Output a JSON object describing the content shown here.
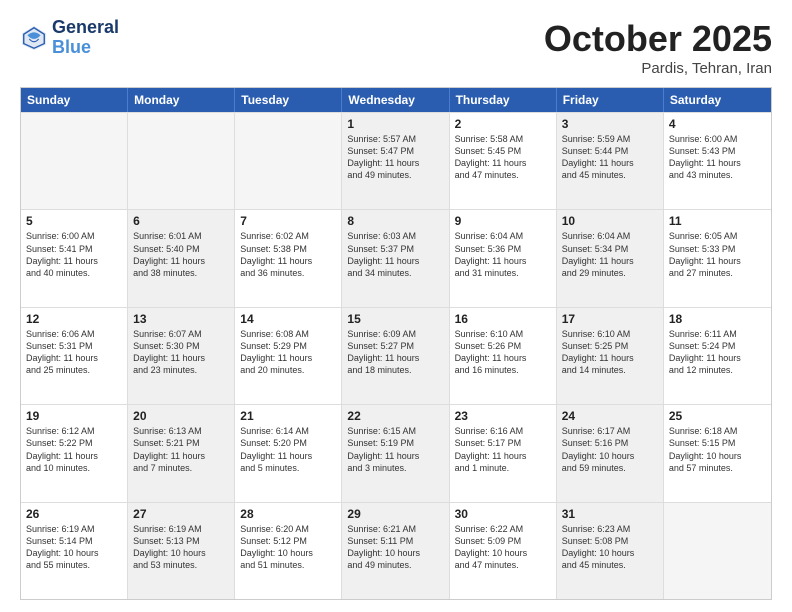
{
  "header": {
    "logo_line1": "General",
    "logo_line2": "Blue",
    "month": "October 2025",
    "location": "Pardis, Tehran, Iran"
  },
  "weekdays": [
    "Sunday",
    "Monday",
    "Tuesday",
    "Wednesday",
    "Thursday",
    "Friday",
    "Saturday"
  ],
  "rows": [
    [
      {
        "day": "",
        "text": "",
        "empty": true
      },
      {
        "day": "",
        "text": "",
        "empty": true
      },
      {
        "day": "",
        "text": "",
        "empty": true
      },
      {
        "day": "1",
        "text": "Sunrise: 5:57 AM\nSunset: 5:47 PM\nDaylight: 11 hours\nand 49 minutes.",
        "shaded": true
      },
      {
        "day": "2",
        "text": "Sunrise: 5:58 AM\nSunset: 5:45 PM\nDaylight: 11 hours\nand 47 minutes.",
        "shaded": false
      },
      {
        "day": "3",
        "text": "Sunrise: 5:59 AM\nSunset: 5:44 PM\nDaylight: 11 hours\nand 45 minutes.",
        "shaded": true
      },
      {
        "day": "4",
        "text": "Sunrise: 6:00 AM\nSunset: 5:43 PM\nDaylight: 11 hours\nand 43 minutes.",
        "shaded": false
      }
    ],
    [
      {
        "day": "5",
        "text": "Sunrise: 6:00 AM\nSunset: 5:41 PM\nDaylight: 11 hours\nand 40 minutes.",
        "shaded": false
      },
      {
        "day": "6",
        "text": "Sunrise: 6:01 AM\nSunset: 5:40 PM\nDaylight: 11 hours\nand 38 minutes.",
        "shaded": true
      },
      {
        "day": "7",
        "text": "Sunrise: 6:02 AM\nSunset: 5:38 PM\nDaylight: 11 hours\nand 36 minutes.",
        "shaded": false
      },
      {
        "day": "8",
        "text": "Sunrise: 6:03 AM\nSunset: 5:37 PM\nDaylight: 11 hours\nand 34 minutes.",
        "shaded": true
      },
      {
        "day": "9",
        "text": "Sunrise: 6:04 AM\nSunset: 5:36 PM\nDaylight: 11 hours\nand 31 minutes.",
        "shaded": false
      },
      {
        "day": "10",
        "text": "Sunrise: 6:04 AM\nSunset: 5:34 PM\nDaylight: 11 hours\nand 29 minutes.",
        "shaded": true
      },
      {
        "day": "11",
        "text": "Sunrise: 6:05 AM\nSunset: 5:33 PM\nDaylight: 11 hours\nand 27 minutes.",
        "shaded": false
      }
    ],
    [
      {
        "day": "12",
        "text": "Sunrise: 6:06 AM\nSunset: 5:31 PM\nDaylight: 11 hours\nand 25 minutes.",
        "shaded": false
      },
      {
        "day": "13",
        "text": "Sunrise: 6:07 AM\nSunset: 5:30 PM\nDaylight: 11 hours\nand 23 minutes.",
        "shaded": true
      },
      {
        "day": "14",
        "text": "Sunrise: 6:08 AM\nSunset: 5:29 PM\nDaylight: 11 hours\nand 20 minutes.",
        "shaded": false
      },
      {
        "day": "15",
        "text": "Sunrise: 6:09 AM\nSunset: 5:27 PM\nDaylight: 11 hours\nand 18 minutes.",
        "shaded": true
      },
      {
        "day": "16",
        "text": "Sunrise: 6:10 AM\nSunset: 5:26 PM\nDaylight: 11 hours\nand 16 minutes.",
        "shaded": false
      },
      {
        "day": "17",
        "text": "Sunrise: 6:10 AM\nSunset: 5:25 PM\nDaylight: 11 hours\nand 14 minutes.",
        "shaded": true
      },
      {
        "day": "18",
        "text": "Sunrise: 6:11 AM\nSunset: 5:24 PM\nDaylight: 11 hours\nand 12 minutes.",
        "shaded": false
      }
    ],
    [
      {
        "day": "19",
        "text": "Sunrise: 6:12 AM\nSunset: 5:22 PM\nDaylight: 11 hours\nand 10 minutes.",
        "shaded": false
      },
      {
        "day": "20",
        "text": "Sunrise: 6:13 AM\nSunset: 5:21 PM\nDaylight: 11 hours\nand 7 minutes.",
        "shaded": true
      },
      {
        "day": "21",
        "text": "Sunrise: 6:14 AM\nSunset: 5:20 PM\nDaylight: 11 hours\nand 5 minutes.",
        "shaded": false
      },
      {
        "day": "22",
        "text": "Sunrise: 6:15 AM\nSunset: 5:19 PM\nDaylight: 11 hours\nand 3 minutes.",
        "shaded": true
      },
      {
        "day": "23",
        "text": "Sunrise: 6:16 AM\nSunset: 5:17 PM\nDaylight: 11 hours\nand 1 minute.",
        "shaded": false
      },
      {
        "day": "24",
        "text": "Sunrise: 6:17 AM\nSunset: 5:16 PM\nDaylight: 10 hours\nand 59 minutes.",
        "shaded": true
      },
      {
        "day": "25",
        "text": "Sunrise: 6:18 AM\nSunset: 5:15 PM\nDaylight: 10 hours\nand 57 minutes.",
        "shaded": false
      }
    ],
    [
      {
        "day": "26",
        "text": "Sunrise: 6:19 AM\nSunset: 5:14 PM\nDaylight: 10 hours\nand 55 minutes.",
        "shaded": false
      },
      {
        "day": "27",
        "text": "Sunrise: 6:19 AM\nSunset: 5:13 PM\nDaylight: 10 hours\nand 53 minutes.",
        "shaded": true
      },
      {
        "day": "28",
        "text": "Sunrise: 6:20 AM\nSunset: 5:12 PM\nDaylight: 10 hours\nand 51 minutes.",
        "shaded": false
      },
      {
        "day": "29",
        "text": "Sunrise: 6:21 AM\nSunset: 5:11 PM\nDaylight: 10 hours\nand 49 minutes.",
        "shaded": true
      },
      {
        "day": "30",
        "text": "Sunrise: 6:22 AM\nSunset: 5:09 PM\nDaylight: 10 hours\nand 47 minutes.",
        "shaded": false
      },
      {
        "day": "31",
        "text": "Sunrise: 6:23 AM\nSunset: 5:08 PM\nDaylight: 10 hours\nand 45 minutes.",
        "shaded": true
      },
      {
        "day": "",
        "text": "",
        "empty": true
      }
    ]
  ]
}
